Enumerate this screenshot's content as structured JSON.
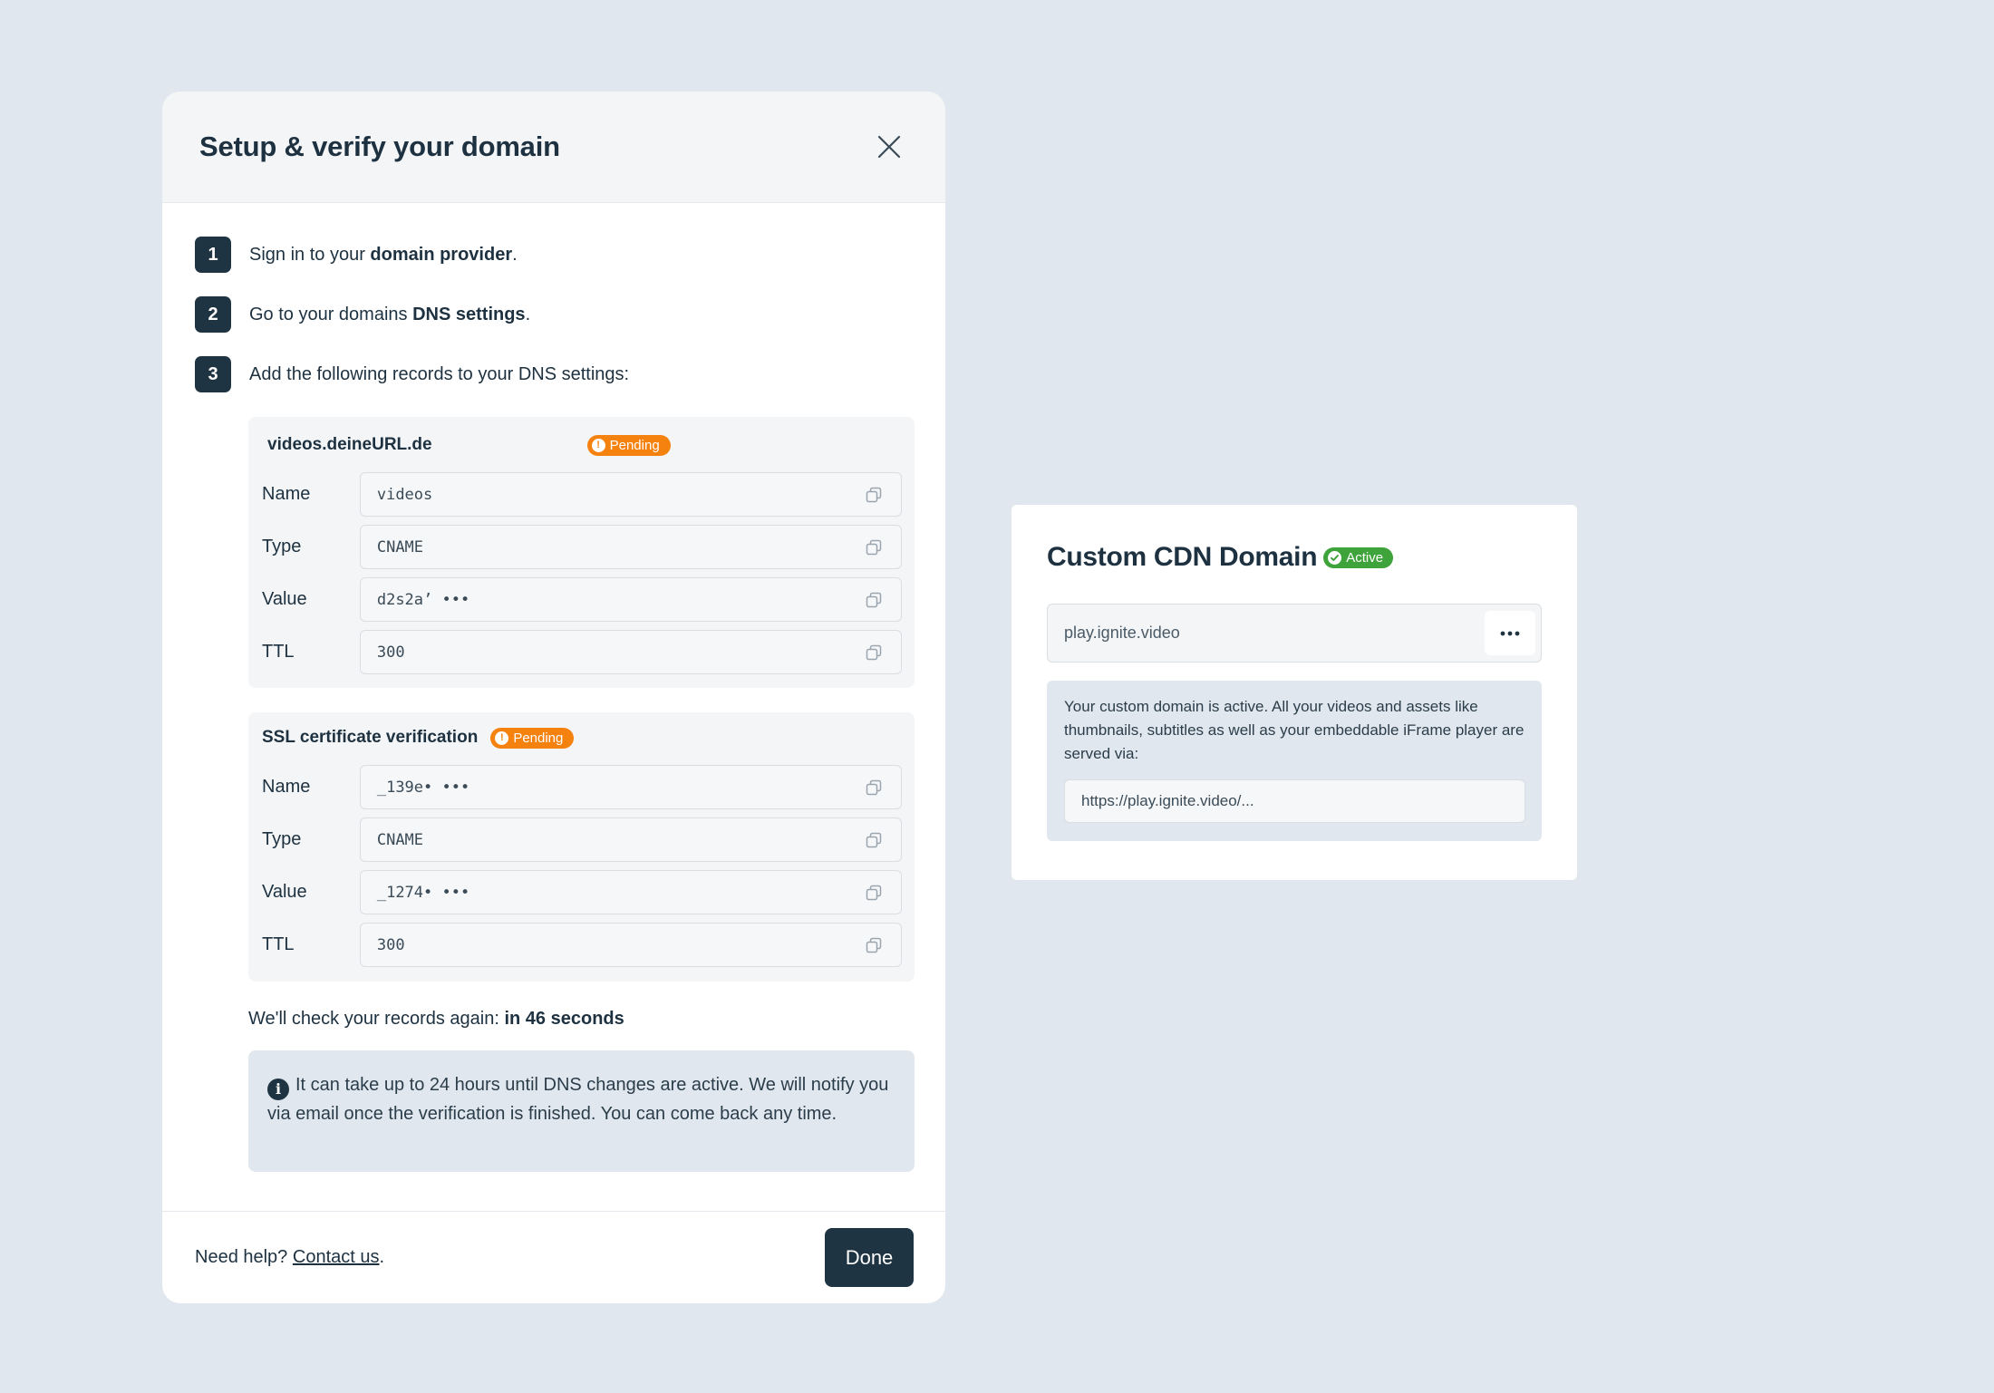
{
  "modal": {
    "title": "Setup & verify your domain",
    "steps": [
      {
        "num": "1",
        "pre": "Sign in to your ",
        "bold": "domain provider",
        "post": "."
      },
      {
        "num": "2",
        "pre": "Go to your domains ",
        "bold": "DNS settings",
        "post": "."
      },
      {
        "num": "3",
        "pre": "Add the following records to your DNS settings:",
        "bold": "",
        "post": ""
      }
    ],
    "records": [
      {
        "title": "videos.deineURL.de",
        "status": "Pending",
        "fields": [
          {
            "label": "Name",
            "value": "videos"
          },
          {
            "label": "Type",
            "value": "CNAME"
          },
          {
            "label": "Value",
            "value": "d2s2a’ •••"
          },
          {
            "label": "TTL",
            "value": "300"
          }
        ]
      },
      {
        "title": "SSL certificate verification",
        "status": "Pending",
        "fields": [
          {
            "label": "Name",
            "value": "_139e• •••"
          },
          {
            "label": "Type",
            "value": "CNAME"
          },
          {
            "label": "Value",
            "value": "_1274• •••"
          },
          {
            "label": "TTL",
            "value": "300"
          }
        ]
      }
    ],
    "recheck_pre": "We'll check your records again: ",
    "recheck_bold": "in 46 seconds",
    "info_text": "It can take up to 24 hours until DNS changes are active. We will notify you via email once the verification is finished. You can come back any time.",
    "footer": {
      "help_pre": "Need help? ",
      "help_link": "Contact us",
      "help_post": ".",
      "done_label": "Done"
    }
  },
  "cdn": {
    "title": "Custom CDN Domain",
    "status": "Active",
    "domain": "play.ignite.video",
    "info_text": "Your custom domain is active. All your videos and assets like thumbnails, subtitles as well as your embeddable iFrame player are served via:",
    "url": "https://play.ignite.video/..."
  },
  "colors": {
    "background": "#e1e7ee",
    "primary": "#1f3442",
    "pending": "#f5810f",
    "active": "#3ea33a"
  },
  "icons": {
    "close": "close-icon",
    "copy": "copy-icon",
    "info": "info-icon",
    "more": "more-horizontal-icon",
    "check": "check-circle-icon"
  }
}
